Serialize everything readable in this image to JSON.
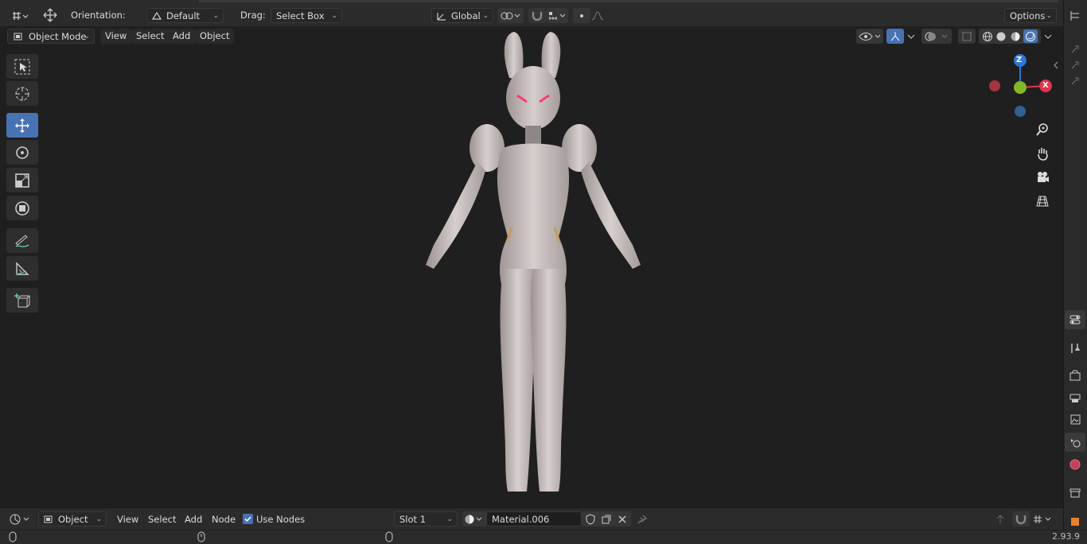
{
  "header": {
    "orientation_label": "Orientation:",
    "orientation_value": "Default",
    "drag_label": "Drag:",
    "drag_value": "Select Box",
    "transform_pivot": "Global",
    "options_label": "Options"
  },
  "viewport_header": {
    "mode": "Object Mode",
    "menus": [
      "View",
      "Select",
      "Add",
      "Object"
    ]
  },
  "gizmo": {
    "z": "Z",
    "x": "X",
    "colors": {
      "x": "#e0344f",
      "y": "#83b825",
      "z": "#2e76d2"
    }
  },
  "node_editor_header": {
    "editor_type": "Object",
    "menus": [
      "View",
      "Select",
      "Add",
      "Node"
    ],
    "use_nodes_label": "Use Nodes",
    "use_nodes_checked": true,
    "slot": "Slot 1",
    "material": "Material.006"
  },
  "status": {
    "version": "2.93.9"
  },
  "colors": {
    "accent": "#4772b3",
    "background": "#1f1f1f",
    "panel": "#2b2b2b"
  }
}
